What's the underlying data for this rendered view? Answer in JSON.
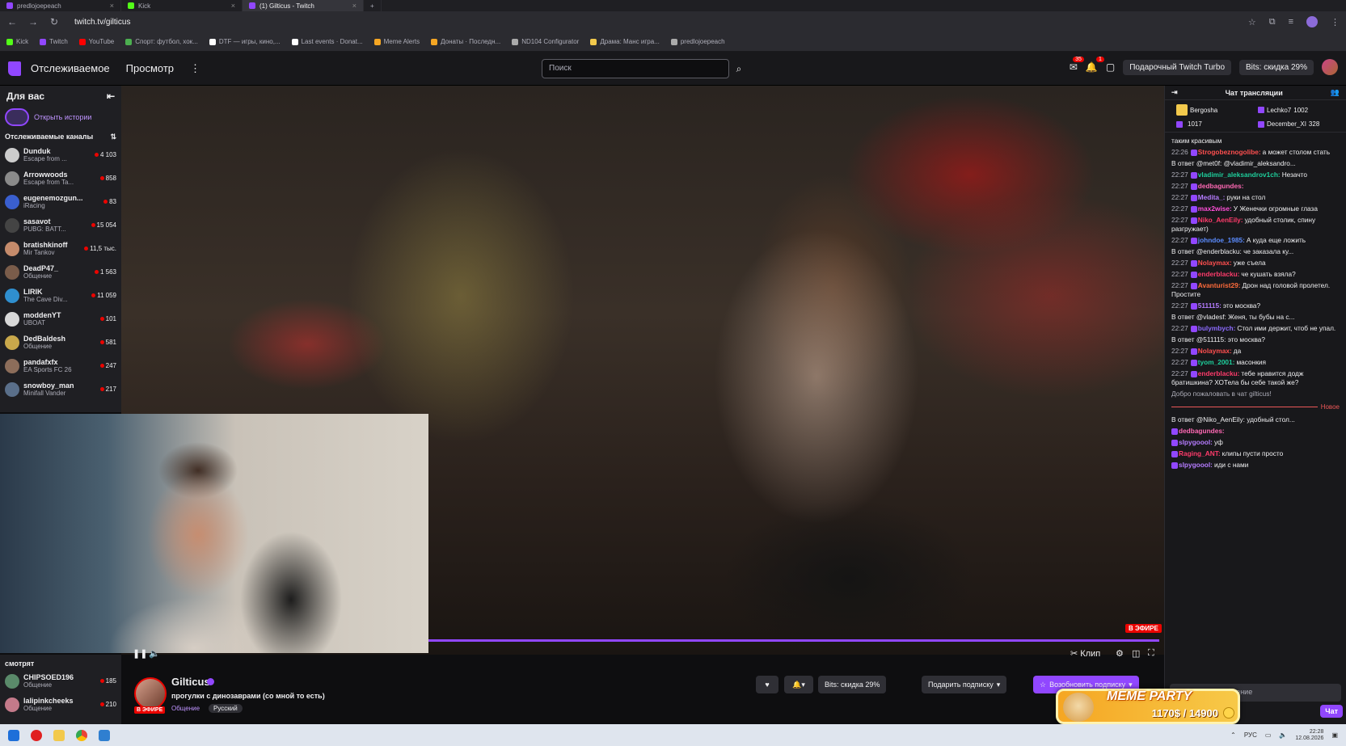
{
  "browser": {
    "tabs": [
      {
        "label": "predlojoepeach",
        "color": "#9147ff",
        "active": false
      },
      {
        "label": "Kick",
        "color": "#53fc18",
        "active": false
      },
      {
        "label": "(1) Gilticus - Twitch",
        "color": "#9147ff",
        "active": true
      }
    ],
    "url": "twitch.tv/gilticus",
    "bookmarks": [
      {
        "label": "Kick",
        "color": "#53fc18"
      },
      {
        "label": "Twitch",
        "color": "#9147ff"
      },
      {
        "label": "YouTube",
        "color": "#ff0000"
      },
      {
        "label": "Спорт: футбол, хок...",
        "color": "#4caf50"
      },
      {
        "label": "DTF — игры, кино,...",
        "color": "#ffffff"
      },
      {
        "label": "Last events · Donat...",
        "color": "#ffffff"
      },
      {
        "label": "Meme Alerts",
        "color": "#f5a623"
      },
      {
        "label": "Донаты · Последн...",
        "color": "#f5a623"
      },
      {
        "label": "ND104 Configurator",
        "color": "#aaaaaa"
      },
      {
        "label": "Драма: Манс игра...",
        "color": "#f2c94c"
      },
      {
        "label": "predlojoepeach",
        "color": "#aaaaaa"
      }
    ]
  },
  "nav": {
    "following": "Отслеживаемое",
    "browse": "Просмотр",
    "search_placeholder": "Поиск",
    "badge_inbox": "35",
    "badge_notif": "1",
    "turbo": "Подарочный Twitch Turbo",
    "bits": "Bits: скидка 29%"
  },
  "sidebar": {
    "title": "Для вас",
    "stories": "Открыть истории",
    "followed_title": "Отслеживаемые каналы",
    "channels": [
      {
        "name": "Dunduk",
        "game": "Escape from ...",
        "viewers": "4 103",
        "color": "#cccccc"
      },
      {
        "name": "Arrowwoods",
        "game": "Escape from Ta...",
        "viewers": "858",
        "color": "#8a8a8a"
      },
      {
        "name": "eugenemozgun...",
        "game": "iRacing",
        "viewers": "83",
        "color": "#3a5fcf"
      },
      {
        "name": "sasavot",
        "game": "PUBG: BATT...",
        "viewers": "15 054",
        "color": "#444444"
      },
      {
        "name": "bratishkinoff",
        "game": "Mir Tankov",
        "viewers": "11,5 тыс.",
        "color": "#c58b6b"
      },
      {
        "name": "DeadP47_",
        "game": "Общение",
        "viewers": "1 563",
        "color": "#7a5c4a"
      },
      {
        "name": "LIRIK",
        "game": "The Cave Div...",
        "viewers": "11 059",
        "color": "#2f8fcf"
      },
      {
        "name": "moddenYT",
        "game": "UBOAT",
        "viewers": "101",
        "color": "#d8d8d8"
      },
      {
        "name": "DedBaldesh",
        "game": "Общение",
        "viewers": "581",
        "color": "#c9a84b"
      },
      {
        "name": "pandafxfx",
        "game": "EA Sports FC 26",
        "viewers": "247",
        "color": "#8c6d5a"
      },
      {
        "name": "snowboy_man",
        "game": "Minifall Vander",
        "viewers": "217",
        "color": "#5a6f8a"
      }
    ],
    "watching_title": "смотрят",
    "watching": [
      {
        "name": "CHIPSOED196",
        "game": "Общение",
        "viewers": "185",
        "color": "#5a8a6a"
      },
      {
        "name": "lalipinkcheeks",
        "game": "Общение",
        "viewers": "210",
        "color": "#c47a8a"
      }
    ]
  },
  "player": {
    "live_label": "В ЭФИРЕ",
    "clip_label": "Клип",
    "progress": 1.0
  },
  "stream": {
    "streamer": "Gilticus",
    "title": "прогулки с динозаврами (со мной то есть)",
    "category": "Общение",
    "tag": "Русский",
    "live_badge": "В ЭФИРЕ",
    "bits_btn": "Bits: скидка 29%",
    "gift_btn": "Подарить подписку",
    "resub_btn": "Возобновить подписку"
  },
  "chat": {
    "title": "Чат трансляции",
    "leaderboard": [
      {
        "name": "Bergosha",
        "value": ""
      },
      {
        "name": "Lechko7",
        "value": "1002"
      },
      {
        "name": "",
        "value": "1017"
      },
      {
        "name": "December_XI",
        "value": "328"
      }
    ],
    "messages": [
      {
        "time": "",
        "user": "",
        "color": "#efeff1",
        "text": "таким красивым",
        "reply": ""
      },
      {
        "time": "22:26",
        "user": "Strogobeznogolibe:",
        "color": "#ff4f4f",
        "text": "а может столом стать",
        "reply": ""
      },
      {
        "time": "22:27",
        "user": "vladimir_aleksandrov1ch:",
        "color": "#1ecf9c",
        "text": "Незачто",
        "reply": "В ответ @met0f: @vladimir_aleksandro..."
      },
      {
        "time": "22:27",
        "user": "dedbagundes:",
        "color": "#ff69b4",
        "text": "",
        "reply": ""
      },
      {
        "time": "22:27",
        "user": "Medita_:",
        "color": "#b57cff",
        "text": "руки на стол",
        "reply": ""
      },
      {
        "time": "22:27",
        "user": "max2wise:",
        "color": "#ff4fd8",
        "text": "У Женечки огромные глаза",
        "reply": ""
      },
      {
        "time": "22:27",
        "user": "Niko_AenEily:",
        "color": "#ff3b6b",
        "text": "удобный столик, спину разгружает)",
        "reply": ""
      },
      {
        "time": "22:27",
        "user": "johndoe_1985:",
        "color": "#5b8cff",
        "text": "А куда еще ложить",
        "reply": ""
      },
      {
        "time": "22:27",
        "user": "Nolaymax:",
        "color": "#ff4f4f",
        "text": "уже съела",
        "reply": "В ответ @enderblacku: че заказала ку..."
      },
      {
        "time": "22:27",
        "user": "enderblacku:",
        "color": "#ff3b6b",
        "text": "че кушать взяла?",
        "reply": ""
      },
      {
        "time": "22:27",
        "user": "Avanturist29:",
        "color": "#ff6b3b",
        "text": "Дрон над головой пролетел. Простите",
        "reply": ""
      },
      {
        "time": "22:27",
        "user": "511115:",
        "color": "#b57cff",
        "text": "это москва?",
        "reply": ""
      },
      {
        "time": "22:27",
        "user": "bulymbych:",
        "color": "#8c6bff",
        "text": "Стол ими держит, чтоб не упал.",
        "reply": "В ответ @vladesf: Женя, ты бубы на с..."
      },
      {
        "time": "22:27",
        "user": "Nolaymax:",
        "color": "#ff4f4f",
        "text": "да",
        "reply": "В ответ @511115: это москва?"
      },
      {
        "time": "22:27",
        "user": "tyom_2001:",
        "color": "#1ecf9c",
        "text": "масонкия",
        "reply": ""
      },
      {
        "time": "22:27",
        "user": "enderblacku:",
        "color": "#ff3b6b",
        "text": "тебе нравится додж братишкина? ХОТела бы себе такой же?",
        "reply": ""
      }
    ],
    "welcome": "Добро пожаловать в чат gilticus!",
    "new_label": "Новое",
    "messages_after": [
      {
        "time": "",
        "user": "dedbagundes:",
        "color": "#ff69b4",
        "text": "",
        "reply": "В ответ @Niko_AenEily: удобный стол..."
      },
      {
        "time": "",
        "user": "slpygoool:",
        "color": "#b57cff",
        "text": "уф",
        "reply": ""
      },
      {
        "time": "",
        "user": "Raging_ANT:",
        "color": "#ff3b6b",
        "text": "клипы пусти просто",
        "reply": ""
      },
      {
        "time": "",
        "user": "slpygoool:",
        "color": "#b57cff",
        "text": "иди с нами",
        "reply": ""
      }
    ],
    "input_placeholder": "Отправить сообщение",
    "send_label": "Чат"
  },
  "meme_party": {
    "title": "MEME PARTY",
    "value": "1170$ / 14900",
    "progress": 0.0785
  },
  "taskbar": {
    "lang": "РУС",
    "time": "22:28",
    "date": "12.08.2026"
  }
}
